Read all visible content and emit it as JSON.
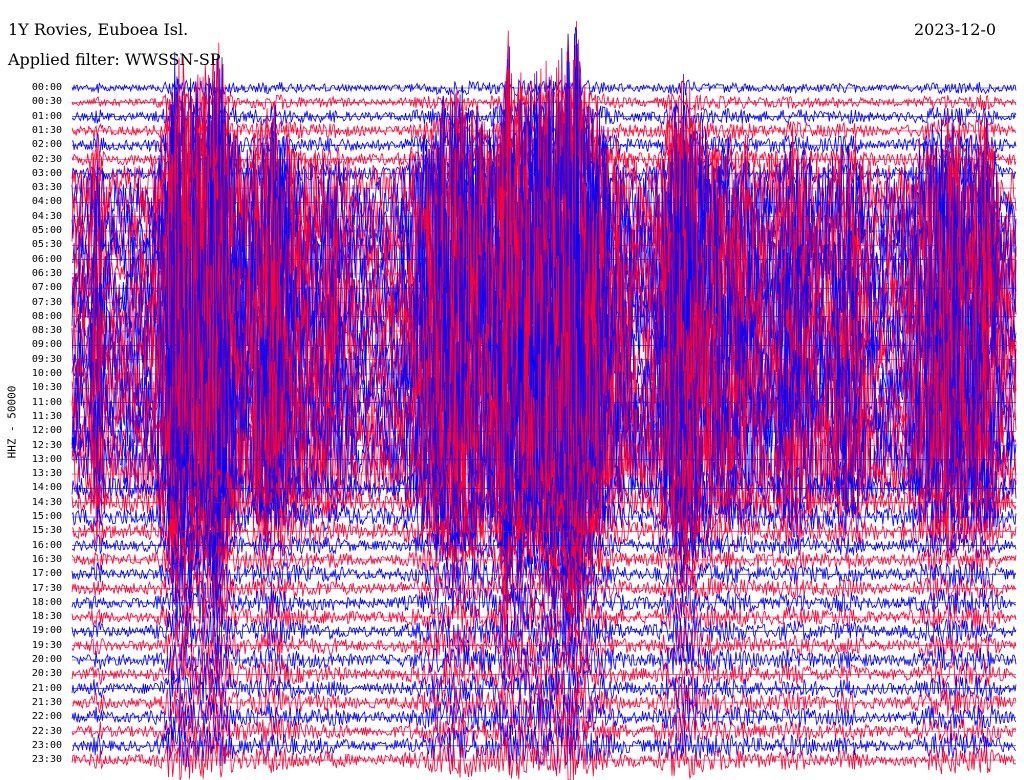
{
  "header": {
    "station": "1Y Rovies, Euboea Isl.",
    "filter": "Applied filter: WWSSN-SP",
    "date": "2023-12-0"
  },
  "chart_data": {
    "type": "helicorder",
    "channel_label": "HHZ - 50000",
    "row_labels": [
      "00:00",
      "00:30",
      "01:00",
      "01:30",
      "02:00",
      "02:30",
      "03:00",
      "03:30",
      "04:00",
      "04:30",
      "05:00",
      "05:30",
      "06:00",
      "06:30",
      "07:00",
      "07:30",
      "08:00",
      "08:30",
      "09:00",
      "09:30",
      "10:00",
      "10:30",
      "11:00",
      "11:30",
      "12:00",
      "12:30",
      "13:00",
      "13:30",
      "14:00",
      "14:30",
      "15:00",
      "15:30",
      "16:00",
      "16:30",
      "17:00",
      "17:30",
      "18:00",
      "18:30",
      "19:00",
      "19:30",
      "20:00",
      "20:30",
      "21:00",
      "21:30",
      "22:00",
      "22:30",
      "23:00",
      "23:30"
    ],
    "series_colors": [
      "#0000ff",
      "#ff0033"
    ],
    "grid": false
  }
}
